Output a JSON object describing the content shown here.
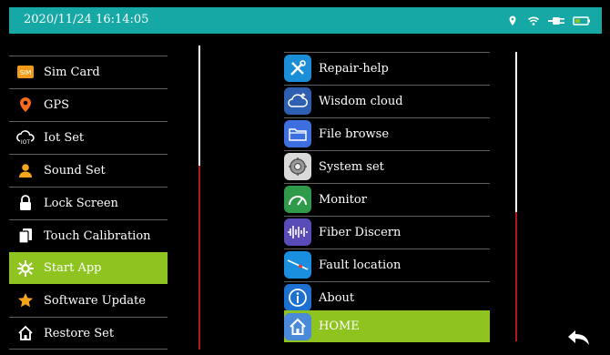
{
  "status": {
    "datetime": "2020/11/24 16:14:05",
    "icons": [
      "location-pin-icon",
      "wifi-icon",
      "plug-icon",
      "battery-icon"
    ],
    "bar_color": "#16a8a5"
  },
  "left_menu": {
    "items": [
      {
        "label": "Sim Card",
        "icon": "sim-card-icon"
      },
      {
        "label": "GPS",
        "icon": "gps-pin-icon"
      },
      {
        "label": "Iot Set",
        "icon": "iot-cloud-icon"
      },
      {
        "label": "Sound Set",
        "icon": "person-icon"
      },
      {
        "label": "Lock Screen",
        "icon": "lock-icon"
      },
      {
        "label": "Touch Calibration",
        "icon": "touch-calibration-icon"
      },
      {
        "label": "Start App",
        "icon": "gear-icon",
        "selected": true
      },
      {
        "label": "Software Update",
        "icon": "star-icon"
      },
      {
        "label": "Restore Set",
        "icon": "home-icon"
      }
    ]
  },
  "right_menu": {
    "items": [
      {
        "label": "Repair-help",
        "icon": "tools-icon"
      },
      {
        "label": "Wisdom cloud",
        "icon": "cloud-icon"
      },
      {
        "label": "File browse",
        "icon": "folder-icon"
      },
      {
        "label": "System set",
        "icon": "settings-icon"
      },
      {
        "label": "Monitor",
        "icon": "gauge-icon"
      },
      {
        "label": "Fiber Discern",
        "icon": "waveform-icon"
      },
      {
        "label": "Fault location",
        "icon": "fault-location-icon"
      },
      {
        "label": "About",
        "icon": "info-icon"
      },
      {
        "label": "HOME",
        "icon": "home-icon",
        "selected": true
      }
    ]
  },
  "accent_color": "#8fc31f",
  "scroll_thumb_color": "#b3151d"
}
